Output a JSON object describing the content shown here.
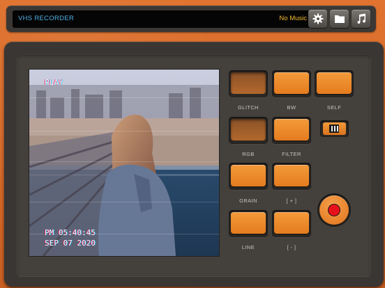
{
  "app": {
    "title": "VHS RECORDER",
    "music_status": "No Music"
  },
  "toolbar": {
    "buttons": [
      {
        "name": "settings",
        "icon": "gear-icon"
      },
      {
        "name": "files",
        "icon": "folder-icon"
      },
      {
        "name": "music",
        "icon": "music-note-icon"
      }
    ]
  },
  "viewport": {
    "osd_mode": "PLAY",
    "osd_time": "PM 05:40:45",
    "osd_date": "SEP 07 2020"
  },
  "effects": {
    "glitch": {
      "label": "GLITCH",
      "active": true
    },
    "bw": {
      "label": "BW",
      "active": false
    },
    "self": {
      "label": "SELF",
      "active": false
    },
    "rgb": {
      "label": "RGB",
      "active": true
    },
    "filter": {
      "label": "FILTER",
      "active": false
    },
    "grain": {
      "label": "GRAIN",
      "active": false
    },
    "plus": {
      "label": "[ + ]",
      "active": false
    },
    "line": {
      "label": "LINE",
      "active": false
    },
    "minus": {
      "label": "[ - ]",
      "active": false
    }
  },
  "colors": {
    "accent_orange": "#e8862a",
    "record_red": "#e8101b",
    "title_blue": "#4fb1e6",
    "music_yellow": "#f0b832"
  }
}
